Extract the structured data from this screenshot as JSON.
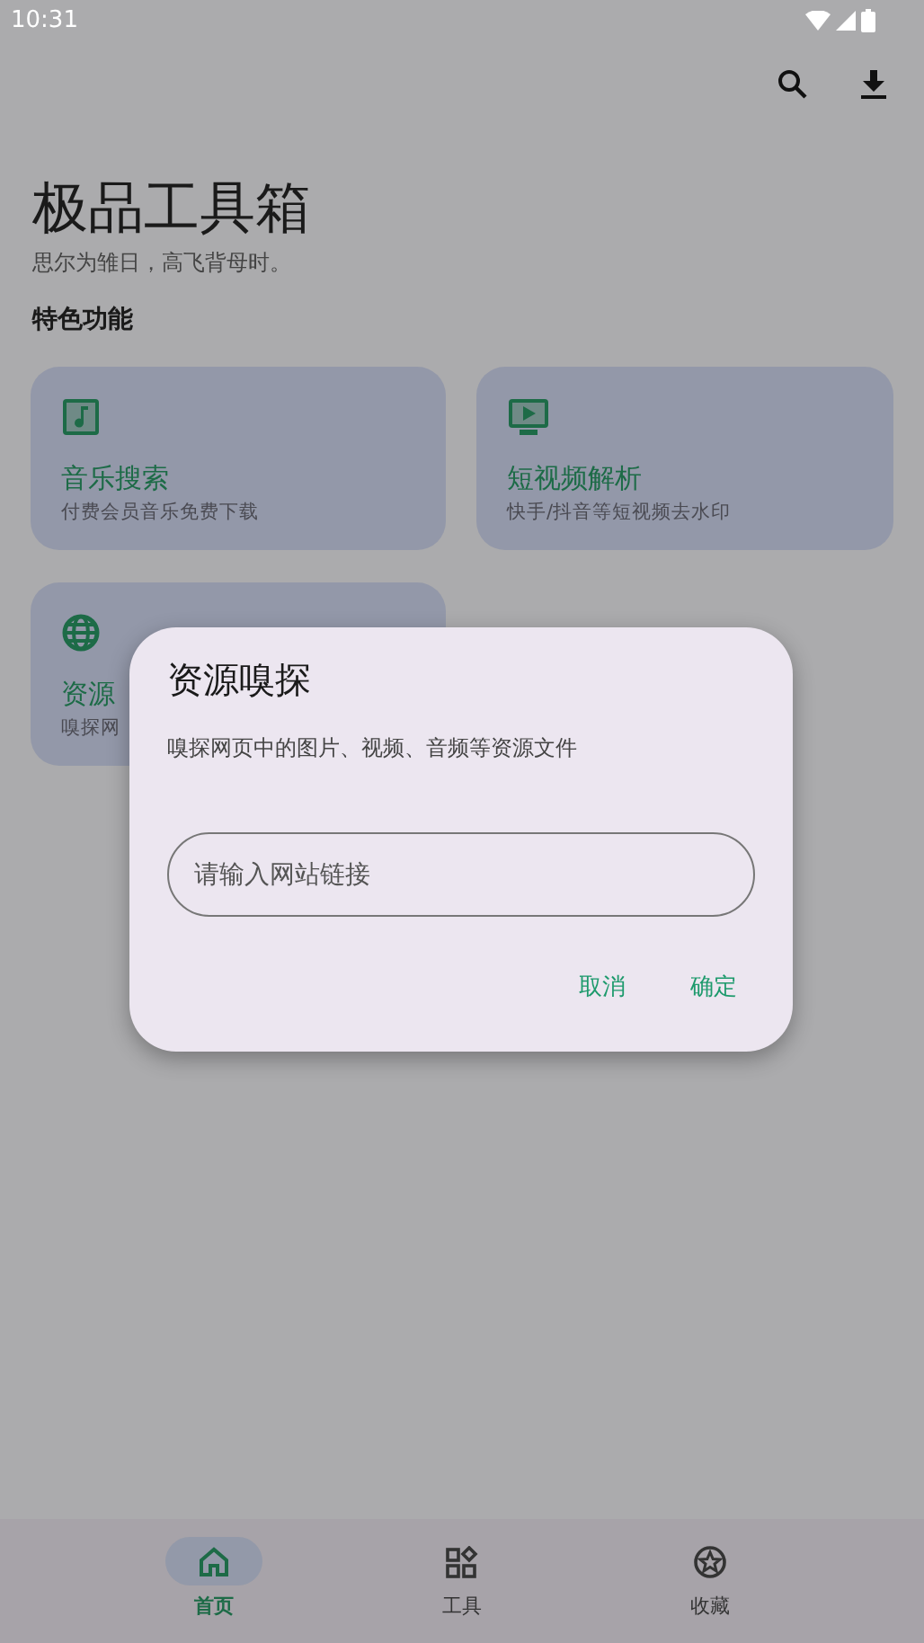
{
  "status_bar": {
    "time": "10:31"
  },
  "header": {
    "title": "极品工具箱",
    "subtitle": "思尔为雏日，高飞背母时。"
  },
  "section_title": "特色功能",
  "features": [
    {
      "title": "音乐搜索",
      "subtitle": "付费会员音乐免费下载"
    },
    {
      "title": "短视频解析",
      "subtitle": "快手/抖音等短视频去水印"
    },
    {
      "title": "资源",
      "subtitle": "嗅探网"
    }
  ],
  "dialog": {
    "title": "资源嗅探",
    "message": "嗅探网页中的图片、视频、音频等资源文件",
    "input": {
      "placeholder": "请输入网站链接"
    },
    "buttons": [
      "取消",
      "确定"
    ]
  },
  "bottom_nav": [
    {
      "label": "首页",
      "selected": true
    },
    {
      "label": "工具",
      "selected": false
    },
    {
      "label": "收藏",
      "selected": false
    }
  ]
}
